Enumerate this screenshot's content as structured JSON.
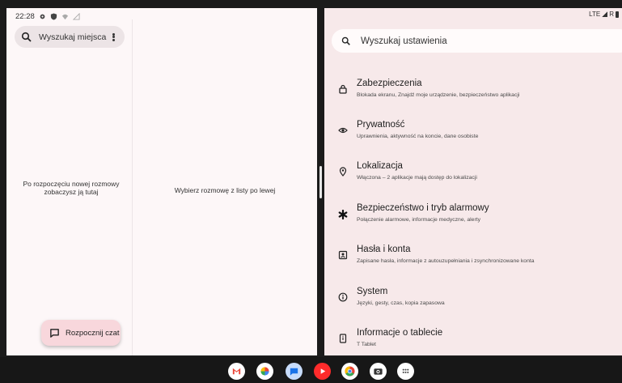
{
  "status_bar_left": {
    "time": "22:28"
  },
  "status_bar_right": {
    "network": "LTE",
    "roaming": "R"
  },
  "messages": {
    "search_placeholder": "Wyszukaj miejsca",
    "empty_list_text": "Po rozpoczęciu nowej rozmowy zobaczysz ją tutaj",
    "select_conversation_text": "Wybierz rozmowę z listy po lewej",
    "fab_label": "Rozpocznij czat"
  },
  "settings": {
    "search_placeholder": "Wyszukaj ustawienia",
    "items": [
      {
        "icon": "lock-icon",
        "title": "Zabezpieczenia",
        "subtitle": "Blokada ekranu, Znajdź moje urządzenie, bezpieczeństwo aplikacji"
      },
      {
        "icon": "privacy-eye-icon",
        "title": "Prywatność",
        "subtitle": "Uprawnienia, aktywność na koncie, dane osobiste"
      },
      {
        "icon": "location-pin-icon",
        "title": "Lokalizacja",
        "subtitle": "Włączona – 2 aplikacje mają dostęp do lokalizacji"
      },
      {
        "icon": "emergency-asterisk-icon",
        "title": "Bezpieczeństwo i tryb alarmowy",
        "subtitle": "Połączenie alarmowe, informacje medyczne, alerty"
      },
      {
        "icon": "accounts-icon",
        "title": "Hasła i konta",
        "subtitle": "Zapisane hasła, informacje z autouzupełniania i zsynchronizowane konta"
      },
      {
        "icon": "info-icon",
        "title": "System",
        "subtitle": "Języki, gesty, czas, kopia zapasowa"
      },
      {
        "icon": "tablet-icon",
        "title": "Informacje o tablecie",
        "subtitle": "T Tablet"
      }
    ]
  },
  "dock": {
    "apps": [
      {
        "name": "gmail-icon",
        "color": "#ffffff"
      },
      {
        "name": "photos-icon",
        "color": "#ffffff"
      },
      {
        "name": "messages-icon",
        "color": "#c7dcfb"
      },
      {
        "name": "youtube-icon",
        "color": "#ff2b2b"
      },
      {
        "name": "chrome-icon",
        "color": "#ffffff"
      },
      {
        "name": "camera-icon",
        "color": "#ffffff"
      },
      {
        "name": "app-drawer-icon",
        "color": "#ffffff"
      }
    ]
  },
  "colors": {
    "left_pane_bg": "#fdf7f8",
    "right_pane_bg": "#f7e9ea",
    "fab_bg": "#f8d7dc",
    "dock_bg": "#171717"
  }
}
